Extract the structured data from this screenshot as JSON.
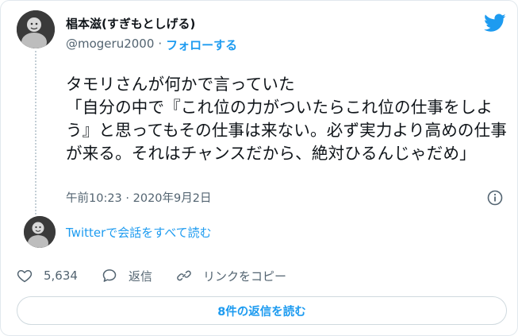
{
  "author": {
    "name": "椙本滋(すぎもとしげる)",
    "handle": "@mogeru2000",
    "separator": "·",
    "follow_label": "フォローする"
  },
  "tweet": {
    "text": "タモリさんが何かで言っていた\n「自分の中で『これ位の力がついたらこれ位の仕事をしよう』と思ってもその仕事は来ない。必ず実力より高めの仕事が来る。それはチャンスだから、絶対ひるんじゃだめ」",
    "time": "午前10:23",
    "separator": "·",
    "date": "2020年9月2日"
  },
  "conversation": {
    "read_label": "Twitterで会話をすべて読む"
  },
  "actions": {
    "like_count": "5,634",
    "reply_label": "返信",
    "copy_link_label": "リンクをコピー"
  },
  "replies_button": {
    "label": "8件の返信を読む"
  },
  "icons": {
    "logo": "twitter-bird-icon",
    "info": "info-icon",
    "like": "heart-icon",
    "reply": "speech-bubble-icon",
    "link": "link-icon"
  },
  "colors": {
    "accent": "#1d9bf0",
    "secondary_text": "#536471",
    "primary_text": "#0f1419",
    "border": "#cfd9de"
  }
}
